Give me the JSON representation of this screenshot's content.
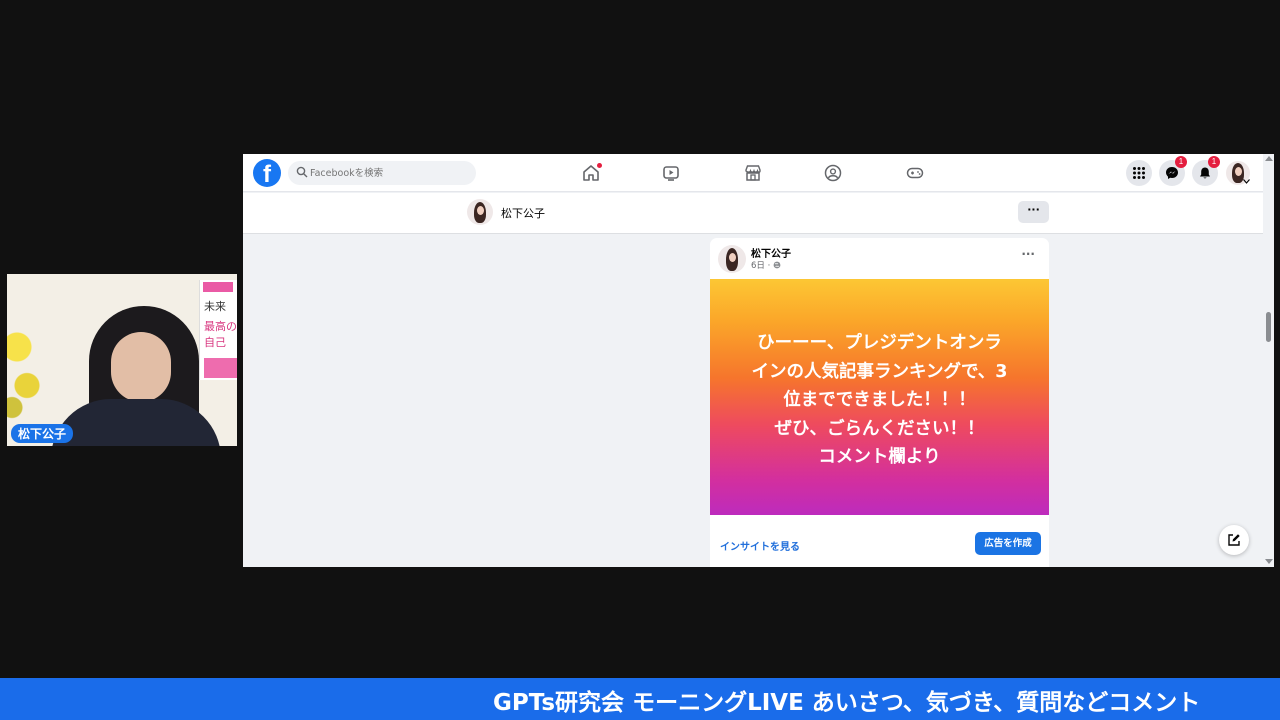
{
  "webcam": {
    "name_tag": "松下公子",
    "book_title_1": "未来",
    "book_title_2": "最高の",
    "book_title_3": "自己"
  },
  "facebook": {
    "search": {
      "placeholder": "Facebookを検索"
    },
    "nav_icons": [
      "home-icon",
      "video-icon",
      "marketplace-icon",
      "groups-icon",
      "gaming-icon"
    ],
    "right_icons": [
      "menu-grid-icon",
      "messenger-icon",
      "notifications-icon",
      "account-avatar"
    ],
    "messenger_badge": "1",
    "notifications_badge": "1",
    "profile_bar": {
      "name": "松下公子",
      "more_label": "···"
    },
    "post": {
      "author": "松下公子",
      "time": "6日 · ",
      "more_label": "···",
      "text": "ひーーー、プレジデントオンラ\nインの人気記事ランキングで、3\n位までできました！！！\nぜひ、ごらんください！！\nコメント欄より",
      "insight_link": "インサイトを見る",
      "ad_button": "広告を作成",
      "gradient_colors": [
        "#fcc734",
        "#f6752c",
        "#ee4a5f",
        "#bd2bbd"
      ]
    },
    "accent_color": "#1877f2"
  },
  "ticker": {
    "text": "GPTs研究会 モーニングLIVE あいさつ、気づき、質問などコメント"
  }
}
